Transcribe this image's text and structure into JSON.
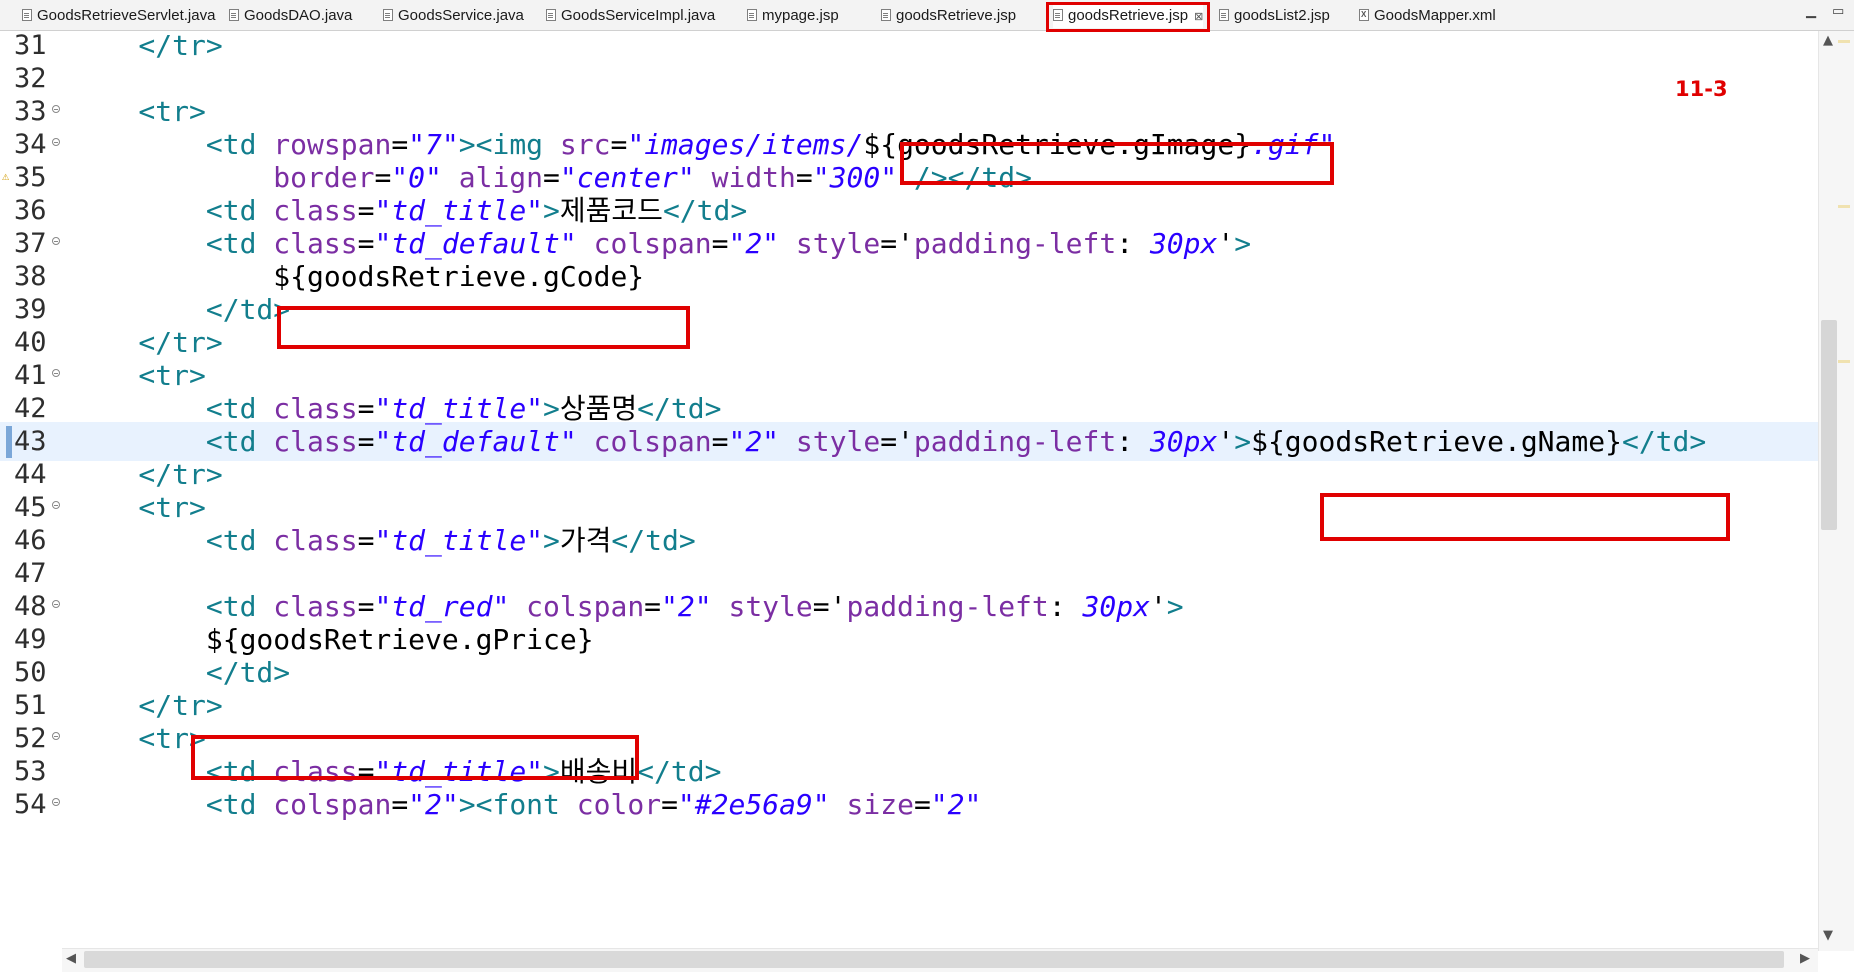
{
  "tabs": [
    {
      "label": "GoodsRetrieveServlet.java",
      "active": false
    },
    {
      "label": "GoodsDAO.java",
      "active": false
    },
    {
      "label": "GoodsService.java",
      "active": false
    },
    {
      "label": "GoodsServiceImpl.java",
      "active": false
    },
    {
      "label": "mypage.jsp",
      "active": false
    },
    {
      "label": "goodsRetrieve.jsp",
      "active": false
    },
    {
      "label": "goodsRetrieve.jsp",
      "active": true
    },
    {
      "label": "goodsList2.jsp",
      "active": false
    },
    {
      "label": "GoodsMapper.xml",
      "active": false
    }
  ],
  "tab_close_glyph": "⊠",
  "window_controls": {
    "minimize": "▁",
    "maximize": "▭"
  },
  "annotation_label": "11-3",
  "editor": {
    "current_line": "43",
    "lines": [
      {
        "n": "31",
        "fold": false,
        "warn": false,
        "segs": [
          {
            "c": "t",
            "v": "    </tr>"
          }
        ]
      },
      {
        "n": "32",
        "fold": false,
        "warn": false,
        "segs": []
      },
      {
        "n": "33",
        "fold": true,
        "warn": false,
        "segs": [
          {
            "c": "t",
            "v": "    <tr>"
          }
        ]
      },
      {
        "n": "34",
        "fold": true,
        "warn": false,
        "segs": [
          {
            "c": "t",
            "v": "        <td "
          },
          {
            "c": "a",
            "v": "rowspan"
          },
          {
            "c": "p",
            "v": "="
          },
          {
            "c": "s",
            "v": "\"7\""
          },
          {
            "c": "t",
            "v": "><img "
          },
          {
            "c": "a",
            "v": "src"
          },
          {
            "c": "p",
            "v": "="
          },
          {
            "c": "s",
            "v": "\"images/items/"
          },
          {
            "c": "e",
            "v": "${goodsRetrieve.gImage}"
          },
          {
            "c": "s",
            "v": ".gif\""
          }
        ]
      },
      {
        "n": "35",
        "fold": false,
        "warn": true,
        "segs": [
          {
            "c": "a",
            "v": "            border"
          },
          {
            "c": "p",
            "v": "="
          },
          {
            "c": "s",
            "v": "\"0\""
          },
          {
            "c": "a",
            "v": " align"
          },
          {
            "c": "p",
            "v": "="
          },
          {
            "c": "s",
            "v": "\"center\""
          },
          {
            "c": "a",
            "v": " width"
          },
          {
            "c": "p",
            "v": "="
          },
          {
            "c": "s",
            "v": "\"300\""
          },
          {
            "c": "t",
            "v": " /></td>"
          }
        ]
      },
      {
        "n": "36",
        "fold": false,
        "warn": false,
        "segs": [
          {
            "c": "t",
            "v": "        <td "
          },
          {
            "c": "a",
            "v": "class"
          },
          {
            "c": "p",
            "v": "="
          },
          {
            "c": "s",
            "v": "\"td_title\""
          },
          {
            "c": "t",
            "v": ">"
          },
          {
            "c": "p",
            "v": "제품코드"
          },
          {
            "c": "t",
            "v": "</td>"
          }
        ]
      },
      {
        "n": "37",
        "fold": true,
        "warn": false,
        "segs": [
          {
            "c": "t",
            "v": "        <td "
          },
          {
            "c": "a",
            "v": "class"
          },
          {
            "c": "p",
            "v": "="
          },
          {
            "c": "s",
            "v": "\"td_default\""
          },
          {
            "c": "a",
            "v": " colspan"
          },
          {
            "c": "p",
            "v": "="
          },
          {
            "c": "s",
            "v": "\"2\""
          },
          {
            "c": "a",
            "v": " style"
          },
          {
            "c": "p",
            "v": "='"
          },
          {
            "c": "a",
            "v": "padding-left"
          },
          {
            "c": "p",
            "v": ": "
          },
          {
            "c": "s",
            "v": "30px"
          },
          {
            "c": "p",
            "v": "'"
          },
          {
            "c": "t",
            "v": ">"
          }
        ]
      },
      {
        "n": "38",
        "fold": false,
        "warn": false,
        "segs": [
          {
            "c": "e",
            "v": "            ${goodsRetrieve.gCode}"
          }
        ]
      },
      {
        "n": "39",
        "fold": false,
        "warn": false,
        "segs": [
          {
            "c": "t",
            "v": "        </td>"
          }
        ]
      },
      {
        "n": "40",
        "fold": false,
        "warn": false,
        "segs": [
          {
            "c": "t",
            "v": "    </tr>"
          }
        ]
      },
      {
        "n": "41",
        "fold": true,
        "warn": false,
        "segs": [
          {
            "c": "t",
            "v": "    <tr>"
          }
        ]
      },
      {
        "n": "42",
        "fold": false,
        "warn": false,
        "segs": [
          {
            "c": "t",
            "v": "        <td "
          },
          {
            "c": "a",
            "v": "class"
          },
          {
            "c": "p",
            "v": "="
          },
          {
            "c": "s",
            "v": "\"td_title\""
          },
          {
            "c": "t",
            "v": ">"
          },
          {
            "c": "p",
            "v": "상품명"
          },
          {
            "c": "t",
            "v": "</td>"
          }
        ]
      },
      {
        "n": "43",
        "fold": false,
        "warn": false,
        "segs": [
          {
            "c": "t",
            "v": "        <td "
          },
          {
            "c": "a",
            "v": "class"
          },
          {
            "c": "p",
            "v": "="
          },
          {
            "c": "s",
            "v": "\"td_default\""
          },
          {
            "c": "a",
            "v": " colspan"
          },
          {
            "c": "p",
            "v": "="
          },
          {
            "c": "s",
            "v": "\"2\""
          },
          {
            "c": "a",
            "v": " style"
          },
          {
            "c": "p",
            "v": "='"
          },
          {
            "c": "a",
            "v": "padding-left"
          },
          {
            "c": "p",
            "v": ": "
          },
          {
            "c": "s",
            "v": "30px"
          },
          {
            "c": "p",
            "v": "'"
          },
          {
            "c": "t",
            "v": ">"
          },
          {
            "c": "e",
            "v": "${goodsRetrieve.gName}"
          },
          {
            "c": "t",
            "v": "</td>"
          }
        ]
      },
      {
        "n": "44",
        "fold": false,
        "warn": false,
        "segs": [
          {
            "c": "t",
            "v": "    </tr>"
          }
        ]
      },
      {
        "n": "45",
        "fold": true,
        "warn": false,
        "segs": [
          {
            "c": "t",
            "v": "    <tr>"
          }
        ]
      },
      {
        "n": "46",
        "fold": false,
        "warn": false,
        "segs": [
          {
            "c": "t",
            "v": "        <td "
          },
          {
            "c": "a",
            "v": "class"
          },
          {
            "c": "p",
            "v": "="
          },
          {
            "c": "s",
            "v": "\"td_title\""
          },
          {
            "c": "t",
            "v": ">"
          },
          {
            "c": "p",
            "v": "가격"
          },
          {
            "c": "t",
            "v": "</td>"
          }
        ]
      },
      {
        "n": "47",
        "fold": false,
        "warn": false,
        "segs": []
      },
      {
        "n": "48",
        "fold": true,
        "warn": false,
        "segs": [
          {
            "c": "t",
            "v": "        <td "
          },
          {
            "c": "a",
            "v": "class"
          },
          {
            "c": "p",
            "v": "="
          },
          {
            "c": "s",
            "v": "\"td_red\""
          },
          {
            "c": "a",
            "v": " colspan"
          },
          {
            "c": "p",
            "v": "="
          },
          {
            "c": "s",
            "v": "\"2\""
          },
          {
            "c": "a",
            "v": " style"
          },
          {
            "c": "p",
            "v": "='"
          },
          {
            "c": "a",
            "v": "padding-left"
          },
          {
            "c": "p",
            "v": ": "
          },
          {
            "c": "s",
            "v": "30px"
          },
          {
            "c": "p",
            "v": "'"
          },
          {
            "c": "t",
            "v": ">"
          }
        ]
      },
      {
        "n": "49",
        "fold": false,
        "warn": false,
        "segs": [
          {
            "c": "e",
            "v": "        ${goodsRetrieve.gPrice}"
          }
        ]
      },
      {
        "n": "50",
        "fold": false,
        "warn": false,
        "segs": [
          {
            "c": "t",
            "v": "        </td>"
          }
        ]
      },
      {
        "n": "51",
        "fold": false,
        "warn": false,
        "segs": [
          {
            "c": "t",
            "v": "    </tr>"
          }
        ]
      },
      {
        "n": "52",
        "fold": true,
        "warn": false,
        "segs": [
          {
            "c": "t",
            "v": "    <tr>"
          }
        ]
      },
      {
        "n": "53",
        "fold": false,
        "warn": false,
        "segs": [
          {
            "c": "t",
            "v": "        <td "
          },
          {
            "c": "a",
            "v": "class"
          },
          {
            "c": "p",
            "v": "="
          },
          {
            "c": "s",
            "v": "\"td_title\""
          },
          {
            "c": "t",
            "v": ">"
          },
          {
            "c": "p",
            "v": "배송비"
          },
          {
            "c": "t",
            "v": "</td>"
          }
        ]
      },
      {
        "n": "54",
        "fold": true,
        "warn": false,
        "segs": [
          {
            "c": "t",
            "v": "        <td "
          },
          {
            "c": "a",
            "v": "colspan"
          },
          {
            "c": "p",
            "v": "="
          },
          {
            "c": "s",
            "v": "\"2\""
          },
          {
            "c": "t",
            "v": "><font "
          },
          {
            "c": "a",
            "v": "color"
          },
          {
            "c": "p",
            "v": "="
          },
          {
            "c": "s",
            "v": "\"#2e56a9\""
          },
          {
            "c": "a",
            "v": " size"
          },
          {
            "c": "p",
            "v": "="
          },
          {
            "c": "s",
            "v": "\"2\""
          }
        ]
      }
    ]
  },
  "scroll_arrows": {
    "up": "▲",
    "down": "▼",
    "left": "◀",
    "right": "▶"
  },
  "colors": {
    "highlight": "#e00000",
    "tag": "#127e8d",
    "attribute": "#7b2ea3",
    "string": "#2a00ff",
    "current_line": "#e8f2fe"
  }
}
